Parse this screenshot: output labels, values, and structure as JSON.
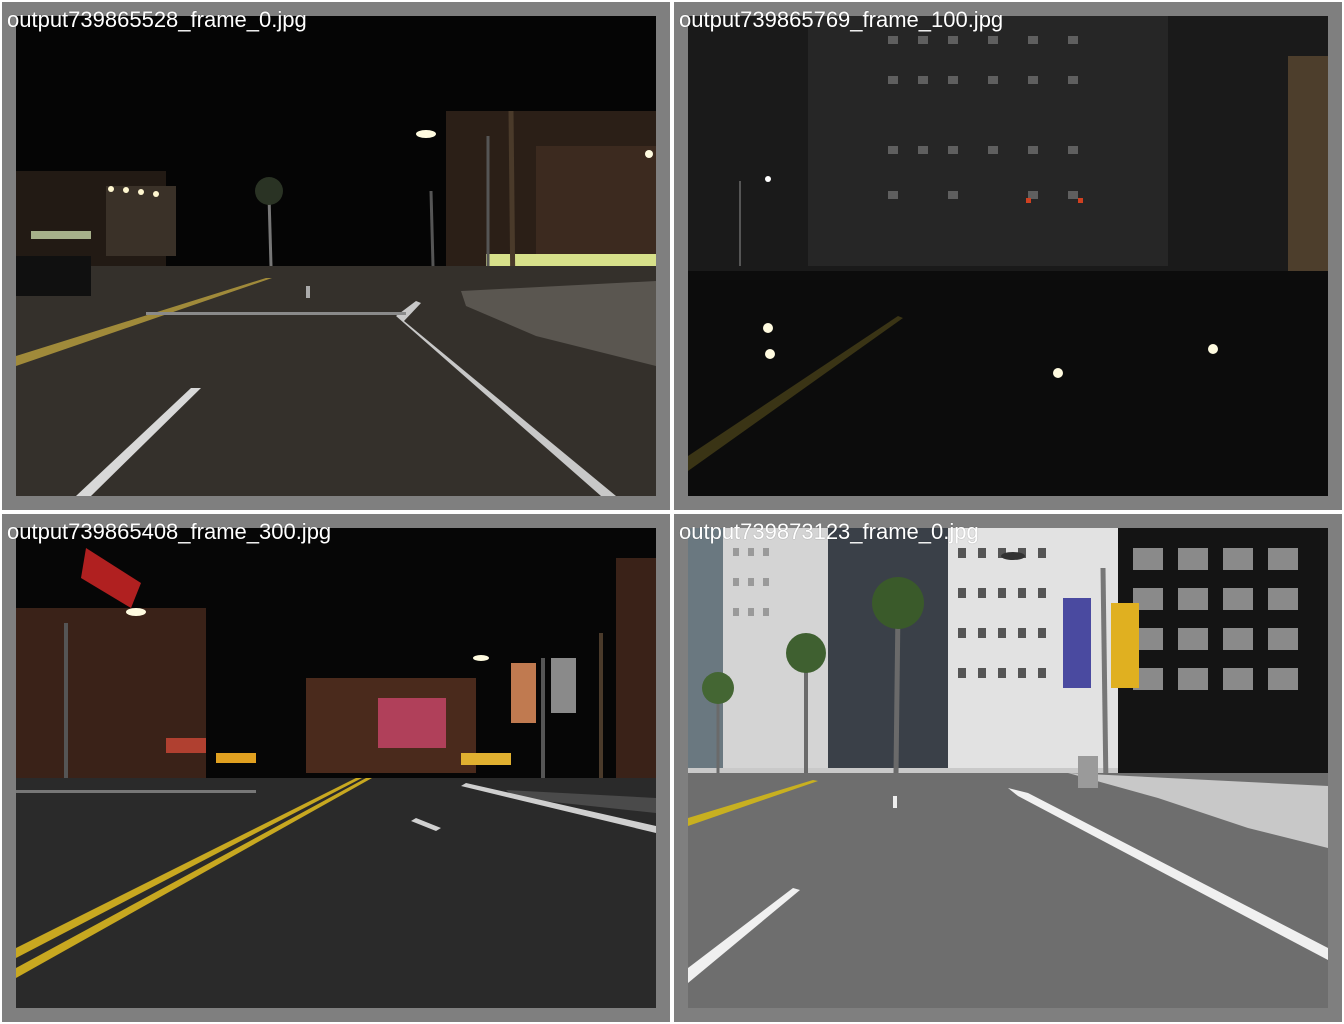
{
  "frames": [
    {
      "filename": "output739865528_frame_0.jpg",
      "scene": "night street intersection with curving lane markings and street lamps"
    },
    {
      "filename": "output739865769_frame_100.jpg",
      "scene": "rainy night street with wet reflective road and high-rise buildings"
    },
    {
      "filename": "output739865408_frame_300.jpg",
      "scene": "night street with double yellow center line, brick buildings and billboards"
    },
    {
      "filename": "output739873123_frame_0.jpg",
      "scene": "daytime wet city street with palm trees and office towers"
    }
  ]
}
